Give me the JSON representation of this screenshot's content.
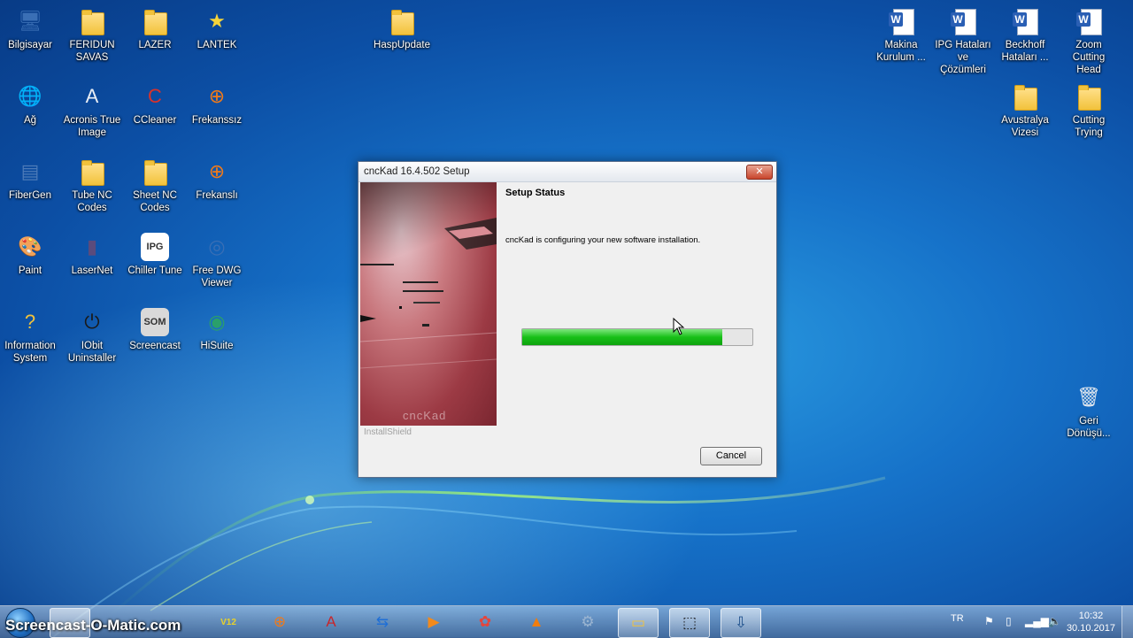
{
  "desktop": {
    "left_icons": [
      {
        "label": "Bilgisayar",
        "icon": "computer-icon",
        "type": "app",
        "glyph": "🖥",
        "color": "#3a6fb5"
      },
      {
        "label": "FERIDUN SAVAS",
        "icon": "folder-icon",
        "type": "folder"
      },
      {
        "label": "LAZER",
        "icon": "folder-icon",
        "type": "folder"
      },
      {
        "label": "LANTEK",
        "icon": "star-icon",
        "type": "app",
        "glyph": "★",
        "color": "#f5d43a"
      },
      {
        "label": "HaspUpdate",
        "icon": "folder-icon",
        "type": "folder"
      },
      {
        "label": "Ağ",
        "icon": "network-icon",
        "type": "app",
        "glyph": "🌐",
        "color": "#2a7ac7"
      },
      {
        "label": "Acronis True Image",
        "icon": "acronis-icon",
        "type": "app",
        "glyph": "A",
        "color": "#e9eef5"
      },
      {
        "label": "CCleaner",
        "icon": "ccleaner-icon",
        "type": "app",
        "glyph": "C",
        "color": "#d8322b"
      },
      {
        "label": "Frekanssız",
        "icon": "frekans-icon",
        "type": "app",
        "glyph": "⊕",
        "color": "#f07a1a"
      },
      {
        "label": "FiberGen",
        "icon": "fibergen-icon",
        "type": "app",
        "glyph": "▤",
        "color": "#4d7bb8"
      },
      {
        "label": "Tube NC Codes",
        "icon": "folder-icon",
        "type": "folder"
      },
      {
        "label": "Sheet NC Codes",
        "icon": "folder-icon",
        "type": "folder"
      },
      {
        "label": "Frekanslı",
        "icon": "frekans-icon",
        "type": "app",
        "glyph": "⊕",
        "color": "#f07a1a"
      },
      {
        "label": "Paint",
        "icon": "paint-icon",
        "type": "app",
        "glyph": "🎨",
        "color": "#c6d9ef"
      },
      {
        "label": "LaserNet",
        "icon": "lasernet-icon",
        "type": "app",
        "glyph": "▮",
        "color": "#5b4b7c"
      },
      {
        "label": "Chiller Tune",
        "icon": "ipg-icon",
        "type": "app",
        "glyph": "IPG",
        "color": "#ffffff"
      },
      {
        "label": "Free DWG Viewer",
        "icon": "dwg-viewer-icon",
        "type": "app",
        "glyph": "◎",
        "color": "#3a6fb5"
      },
      {
        "label": "Information System",
        "icon": "help-icon",
        "type": "app",
        "glyph": "?",
        "color": "#f2c23b"
      },
      {
        "label": "IObit Uninstaller",
        "icon": "iobit-icon",
        "type": "app",
        "glyph": "⏻",
        "color": "#1a1a1a"
      },
      {
        "label": "Screencast",
        "icon": "screencast-icon",
        "type": "app",
        "glyph": "SOM",
        "color": "#d9d9d9"
      },
      {
        "label": "HiSuite",
        "icon": "hisuite-icon",
        "type": "app",
        "glyph": "◉",
        "color": "#2aa06a"
      }
    ],
    "right_icons": [
      {
        "label": "Makina Kurulum ...",
        "icon": "word-doc-icon",
        "type": "word"
      },
      {
        "label": "IPG Hataları ve Çözümleri",
        "icon": "word-doc-icon",
        "type": "word"
      },
      {
        "label": "Beckhoff Hataları ...",
        "icon": "word-doc-icon",
        "type": "word"
      },
      {
        "label": "Zoom Cutting Head",
        "icon": "word-doc-icon",
        "type": "word"
      },
      {
        "label": "Avustralya Vizesi",
        "icon": "folder-icon",
        "type": "folder"
      },
      {
        "label": "Cutting Trying",
        "icon": "folder-icon",
        "type": "folder"
      },
      {
        "label": "Geri Dönüşü...",
        "icon": "recycle-bin-icon",
        "type": "app",
        "glyph": "🗑",
        "color": "#dfe6ee"
      }
    ]
  },
  "dialog": {
    "title": "cncKad 16.4.502 Setup",
    "close_label": "✕",
    "heading": "Setup Status",
    "status_text": "cncKad is configuring your new software installation.",
    "progress_percent": 87,
    "installshield_label": "InstallShield",
    "cancel_label": "Cancel",
    "side_watermark": "cncKad"
  },
  "taskbar": {
    "watermark": "Screencast-O-Matic.com",
    "apps": [
      {
        "icon": "lantek-v12-icon",
        "glyph": "V12",
        "color": "#e8d22a"
      },
      {
        "icon": "frekans-taskbar-icon",
        "glyph": "⊕",
        "color": "#f07a1a"
      },
      {
        "icon": "acrobat-icon",
        "glyph": "A",
        "color": "#c8262b"
      },
      {
        "icon": "teamviewer-icon",
        "glyph": "⇆",
        "color": "#1f6fd6"
      },
      {
        "icon": "media-player-icon",
        "glyph": "▶",
        "color": "#f28a1c"
      },
      {
        "icon": "screenshot-tool-icon",
        "glyph": "✿",
        "color": "#e8443a"
      },
      {
        "icon": "vlc-icon",
        "glyph": "▲",
        "color": "#f07d0e"
      },
      {
        "icon": "settings-gear-icon",
        "glyph": "⚙",
        "color": "#9bb5d1"
      },
      {
        "icon": "file-explorer-icon",
        "glyph": "▭",
        "color": "#f2c23b"
      },
      {
        "icon": "snipping-icon",
        "glyph": "⬚",
        "color": "#1a1a1a"
      },
      {
        "icon": "installer-icon",
        "glyph": "⇩",
        "color": "#1c4e8a"
      }
    ],
    "language": "TR",
    "time": "10:32",
    "date": "30.10.2017"
  }
}
